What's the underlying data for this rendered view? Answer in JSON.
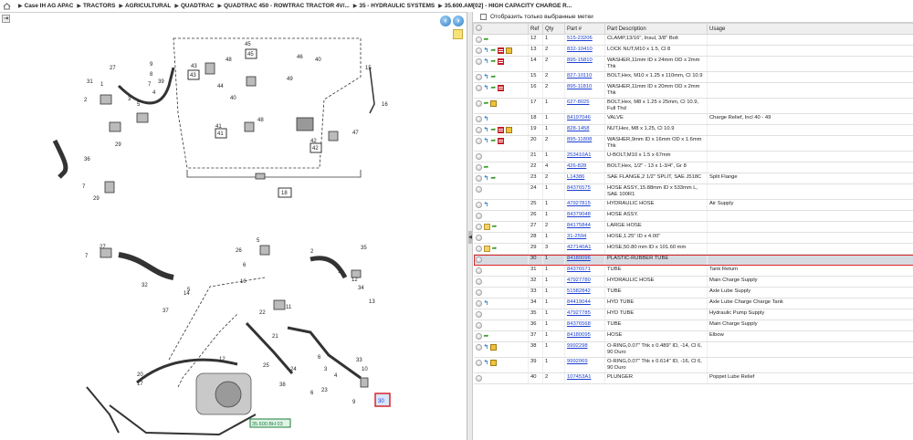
{
  "breadcrumb": [
    "Case IH AG APAC",
    "TRACTORS",
    "AGRICULTURAL",
    "QUADTRAC",
    "QUADTRAC 450 - ROWTRAC TRACTOR 4V/...",
    "35 - HYDRAULIC SYSTEMS",
    "35.600.AM[02] - HIGH CAPACITY CHARGE R..."
  ],
  "filter": {
    "label": "Отобразить только выбранные метки"
  },
  "table": {
    "headers": [
      "",
      "Ref",
      "Qty",
      "Part #",
      "Part Description",
      "Usage"
    ],
    "rows": [
      {
        "icons": [
          "green"
        ],
        "ref": "12",
        "qty": "1",
        "part": "515-23206",
        "desc": "CLAMP,13/16\", Insul, 3/8\" Bolt",
        "usage": ""
      },
      {
        "icons": [
          "blue",
          "green",
          "red",
          "box"
        ],
        "ref": "13",
        "qty": "2",
        "part": "832-10410",
        "desc": "LOCK NUT,M10 x 1.5, Cl 8",
        "usage": ""
      },
      {
        "icons": [
          "blue",
          "green",
          "red"
        ],
        "ref": "14",
        "qty": "2",
        "part": "895-15810",
        "desc": "WASHER,11mm ID x 24mm OD x 2mm Thk",
        "usage": ""
      },
      {
        "icons": [
          "blue",
          "green"
        ],
        "ref": "15",
        "qty": "2",
        "part": "827-10110",
        "desc": "BOLT,Hex, M10 x 1.25 x 110mm, Cl 10.9",
        "usage": ""
      },
      {
        "icons": [
          "blue",
          "green",
          "red"
        ],
        "ref": "16",
        "qty": "2",
        "part": "895-11810",
        "desc": "WASHER,11mm ID x 20mm OD x 2mm Thk",
        "usage": ""
      },
      {
        "icons": [
          "green",
          "box"
        ],
        "ref": "17",
        "qty": "1",
        "part": "627-8025",
        "desc": "BOLT,Hex, M8 x 1.25 x 25mm, Cl 10.9, Full Thd",
        "usage": ""
      },
      {
        "icons": [
          "blue"
        ],
        "ref": "18",
        "qty": "1",
        "part": "84197046",
        "desc": "VALVE",
        "usage": "Charge Relief, Incl 40 - 49"
      },
      {
        "icons": [
          "blue",
          "green",
          "red",
          "box"
        ],
        "ref": "19",
        "qty": "1",
        "part": "828-1458",
        "desc": "NUT,Hex, M8 x 1.25, Cl 10.9",
        "usage": ""
      },
      {
        "icons": [
          "blue",
          "green",
          "red"
        ],
        "ref": "20",
        "qty": "2",
        "part": "895-11808",
        "desc": "WASHER,9mm ID x 16mm OD x 1.6mm Thk",
        "usage": ""
      },
      {
        "icons": [],
        "ref": "21",
        "qty": "1",
        "part": "253410A1",
        "desc": "U-BOLT,M10 x 1.5 x 67mm",
        "usage": ""
      },
      {
        "icons": [
          "green"
        ],
        "ref": "22",
        "qty": "4",
        "part": "426-828",
        "desc": "BOLT,Hex, 1/2\" - 13 x 1-3/4\", Gr 8",
        "usage": ""
      },
      {
        "icons": [
          "blue",
          "green"
        ],
        "ref": "23",
        "qty": "2",
        "part": "L14386",
        "desc": "SAE FLANGE,2 1/2\" SPLIT, SAE J518C",
        "usage": "Split Flange"
      },
      {
        "icons": [],
        "ref": "24",
        "qty": "1",
        "part": "84376575",
        "desc": "HOSE ASSY.,15.88mm ID x 533mm L, SAE 100R1",
        "usage": ""
      },
      {
        "icons": [
          "blue"
        ],
        "ref": "25",
        "qty": "1",
        "part": "47927815",
        "desc": "HYDRAULIC HOSE",
        "usage": "Air Supply"
      },
      {
        "icons": [],
        "ref": "26",
        "qty": "1",
        "part": "84379048",
        "desc": "HOSE ASSY.",
        "usage": ""
      },
      {
        "icons": [
          "note",
          "green"
        ],
        "ref": "27",
        "qty": "2",
        "part": "84175844",
        "desc": "LARGE HOSE",
        "usage": ""
      },
      {
        "icons": [],
        "ref": "28",
        "qty": "1",
        "part": "31-2594",
        "desc": "HOSE,1.25\" ID x 4.00\"",
        "usage": ""
      },
      {
        "icons": [
          "note",
          "green"
        ],
        "ref": "29",
        "qty": "3",
        "part": "427140A1",
        "desc": "HOSE,50.80 mm ID x 101.60 mm",
        "usage": ""
      },
      {
        "icons": [],
        "ref": "30",
        "qty": "1",
        "part": "84180096",
        "desc": "PLASTIC-RUBBER TUBE",
        "usage": "",
        "selected": true
      },
      {
        "icons": [],
        "ref": "31",
        "qty": "1",
        "part": "84376571",
        "desc": "TUBE",
        "usage": "Tank Return"
      },
      {
        "icons": [],
        "ref": "32",
        "qty": "1",
        "part": "47927780",
        "desc": "HYDRAULIC HOSE",
        "usage": "Main Charge Supply"
      },
      {
        "icons": [],
        "ref": "33",
        "qty": "1",
        "part": "51582842",
        "desc": "TUBE",
        "usage": "Axle Lube Supply"
      },
      {
        "icons": [
          "blue"
        ],
        "ref": "34",
        "qty": "1",
        "part": "84419044",
        "desc": "HYD TUBE",
        "usage": "Axle Lube Charge Charge Tank"
      },
      {
        "icons": [],
        "ref": "35",
        "qty": "1",
        "part": "47927785",
        "desc": "HYD TUBE",
        "usage": "Hydraulic Pump Supply"
      },
      {
        "icons": [],
        "ref": "36",
        "qty": "1",
        "part": "84376568",
        "desc": "TUBE",
        "usage": "Main Charge Supply"
      },
      {
        "icons": [
          "green"
        ],
        "ref": "37",
        "qty": "1",
        "part": "84180095",
        "desc": "HOSE",
        "usage": "Elbow"
      },
      {
        "icons": [
          "blue",
          "box"
        ],
        "ref": "38",
        "qty": "1",
        "part": "9992298",
        "desc": "O-RING,0.07\" Thk x 0.489\" ID, -14, Cl 6, 90 Duro",
        "usage": ""
      },
      {
        "icons": [
          "blue",
          "box"
        ],
        "ref": "39",
        "qty": "1",
        "part": "9992069",
        "desc": "O-RING,0.07\" Thk x 0.614\" ID, -16, Cl 6, 90 Duro",
        "usage": ""
      },
      {
        "icons": [],
        "ref": "40",
        "qty": "2",
        "part": "107453A1",
        "desc": "PLUNGER",
        "usage": "Poppet Lube Relief"
      }
    ]
  },
  "diagram": {
    "refs": [
      "9",
      "8",
      "27",
      "31",
      "1",
      "7",
      "2",
      "3",
      "39",
      "4",
      "5",
      "29",
      "36",
      "7",
      "29",
      "45",
      "46",
      "40",
      "48",
      "43",
      "44",
      "49",
      "40",
      "48",
      "41",
      "42",
      "47",
      "15",
      "16",
      "18",
      "26",
      "6",
      "5",
      "10",
      "2",
      "35",
      "1",
      "12",
      "34",
      "13",
      "32",
      "11",
      "22",
      "27",
      "5",
      "37",
      "14",
      "7",
      "6",
      "3",
      "12",
      "20",
      "17",
      "21",
      "25",
      "24",
      "23",
      "33",
      "38",
      "4",
      "10",
      "6",
      "9"
    ],
    "callouts": {
      "c18": "18",
      "c41": "41",
      "c42": "42",
      "c43": "43",
      "c45": "45"
    },
    "link_label": "35.600.BH 03",
    "highlight": "30"
  },
  "colors": {
    "link": "#1a3fd0",
    "selected_outline": "#d9262c",
    "selected_bg": "#d8dbe2",
    "diagram_link": "#1a7f3a"
  }
}
